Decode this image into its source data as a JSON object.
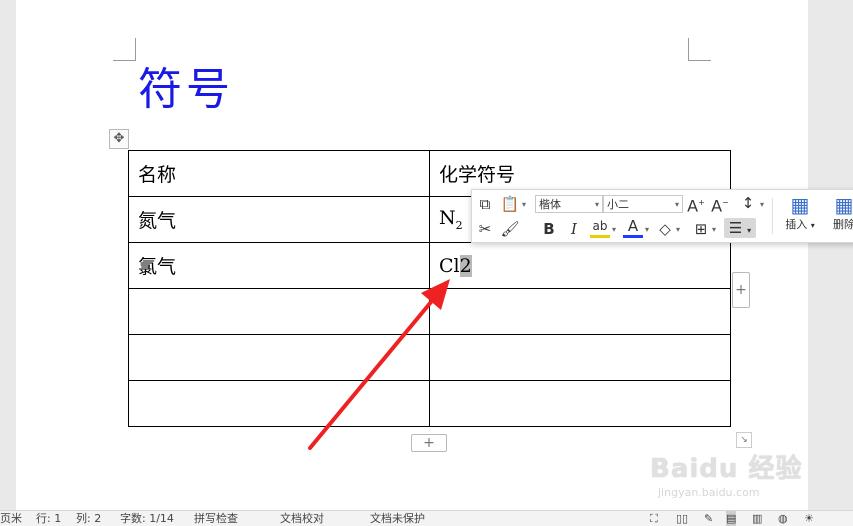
{
  "document": {
    "title": "符号",
    "table": {
      "rows": [
        [
          "名称",
          "化学符号"
        ],
        [
          "氮气",
          "N"
        ],
        [
          "氯气",
          "Cl2"
        ],
        [
          "",
          ""
        ],
        [
          "",
          ""
        ],
        [
          "",
          ""
        ]
      ],
      "n2_subscript": "2",
      "cl2_plain": "Cl",
      "cl2_selected": "2"
    },
    "add_symbol": "+"
  },
  "floating_toolbar": {
    "font_name": "楷体",
    "font_size": "小二",
    "grow_font": "A",
    "shrink_font": "A",
    "bold": "B",
    "italic": "I",
    "highlight": "ab",
    "font_color": "A",
    "insert_label": "插入",
    "delete_label": "删除"
  },
  "watermark": {
    "brand": "Baidu 经验",
    "url": "jingyan.baidu.com"
  },
  "status_bar": {
    "page": "页米",
    "row": "行: 1",
    "column": "列: 2",
    "word_count": "字数: 1/14",
    "spell_check": "拼写检查",
    "doc_proof": "文档校对",
    "doc_protect": "文档未保护"
  },
  "colors": {
    "title": "#1a1ae6",
    "arrow": "#ee2222",
    "font_color_bar": "#1f3bff",
    "highlight_bar": "#e8d000"
  }
}
